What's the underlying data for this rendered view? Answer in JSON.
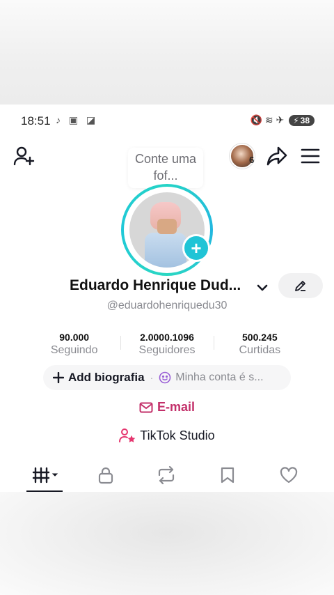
{
  "status_bar": {
    "time": "18:51",
    "left_icons": "♪ ▣ ◪",
    "right_icons": "🔇 ≋ ✈",
    "battery": "38"
  },
  "header": {
    "note_bubble": "Conte uma fof...",
    "story_count": "6"
  },
  "profile": {
    "display_name": "Eduardo Henrique Dud...",
    "username": "@eduardohenriquedu30",
    "add_photo_symbol": "+"
  },
  "stats": [
    {
      "value": "90.000",
      "label": "Seguindo"
    },
    {
      "value": "2.0000.1096",
      "label": "Seguidores"
    },
    {
      "value": "500.245",
      "label": "Curtidas"
    }
  ],
  "bio": {
    "add_label": "Add biografia",
    "separator": "·",
    "hint": "Minha conta é s..."
  },
  "email": {
    "label": "E-mail"
  },
  "studio": {
    "label": "TikTok Studio"
  },
  "tabs": [
    {
      "name": "videos",
      "active": true
    },
    {
      "name": "private",
      "active": false
    },
    {
      "name": "reposts",
      "active": false
    },
    {
      "name": "saved",
      "active": false
    },
    {
      "name": "liked",
      "active": false
    }
  ],
  "colors": {
    "accent_teal": "#20c4d6",
    "email_pink": "#c3306a",
    "text_primary": "#161823",
    "text_secondary": "#8a8b91"
  }
}
